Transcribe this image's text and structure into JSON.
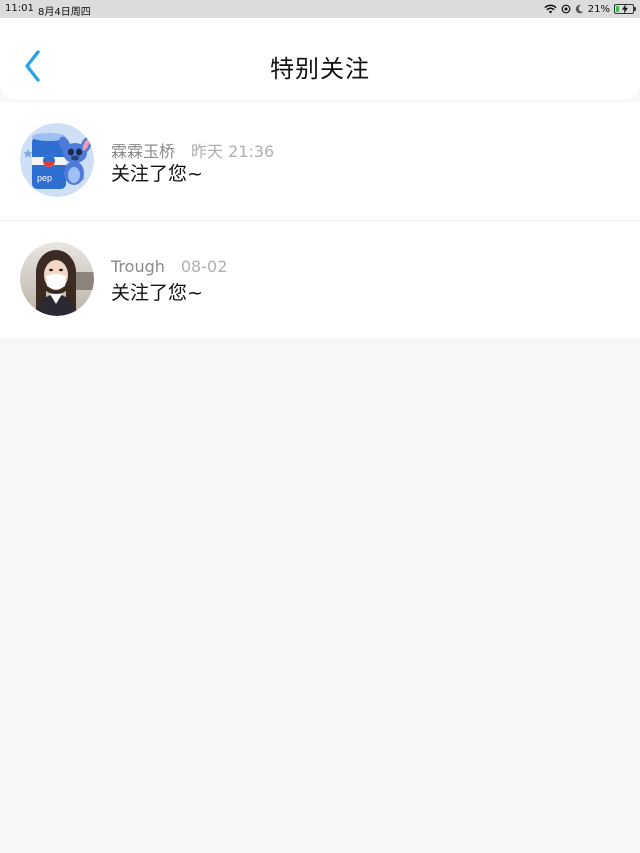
{
  "status_bar": {
    "time": "11:01",
    "date": "8月4日周四",
    "battery_percent": "21%",
    "icons": [
      "wifi-icon",
      "location-icon",
      "moon-icon",
      "battery-icon",
      "charging-icon"
    ],
    "battery_level": 0.21
  },
  "header": {
    "title": "特别关注",
    "back_icon": "chevron-left-icon",
    "accent_color": "#2aa3e8"
  },
  "list": {
    "items": [
      {
        "name": "霖霖玉桥",
        "time": "昨天 21:36",
        "message": "关注了您~",
        "avatar": "cartoon-avatar-stitch-pepsi"
      },
      {
        "name": "Trough",
        "time": "08-02",
        "message": "关注了您~",
        "avatar": "photo-avatar-person-mask"
      }
    ]
  }
}
